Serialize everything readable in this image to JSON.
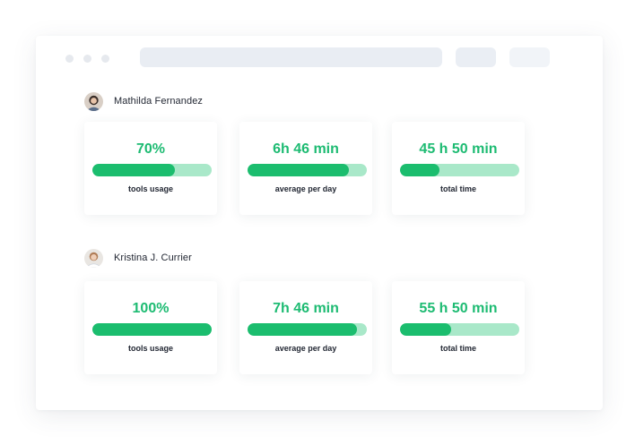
{
  "colors": {
    "accent": "#1bbd6e",
    "track": "#a9e8c9",
    "metric_text": "#1dbb72"
  },
  "users": [
    {
      "name": "Mathilda Fernandez",
      "avatar_icon": "person-avatar-icon",
      "stats": [
        {
          "value": "70%",
          "label": "tools usage",
          "progress": 0.69
        },
        {
          "value": "6h 46 min",
          "label": "average per day",
          "progress": 0.85
        },
        {
          "value": "45 h 50 min",
          "label": "total time",
          "progress": 0.33
        }
      ]
    },
    {
      "name": "Kristina J. Currier",
      "avatar_icon": "person-avatar-icon",
      "stats": [
        {
          "value": "100%",
          "label": "tools usage",
          "progress": 1.0
        },
        {
          "value": "7h 46 min",
          "label": "average per day",
          "progress": 0.92
        },
        {
          "value": "55 h 50 min",
          "label": "total time",
          "progress": 0.43
        }
      ]
    }
  ]
}
